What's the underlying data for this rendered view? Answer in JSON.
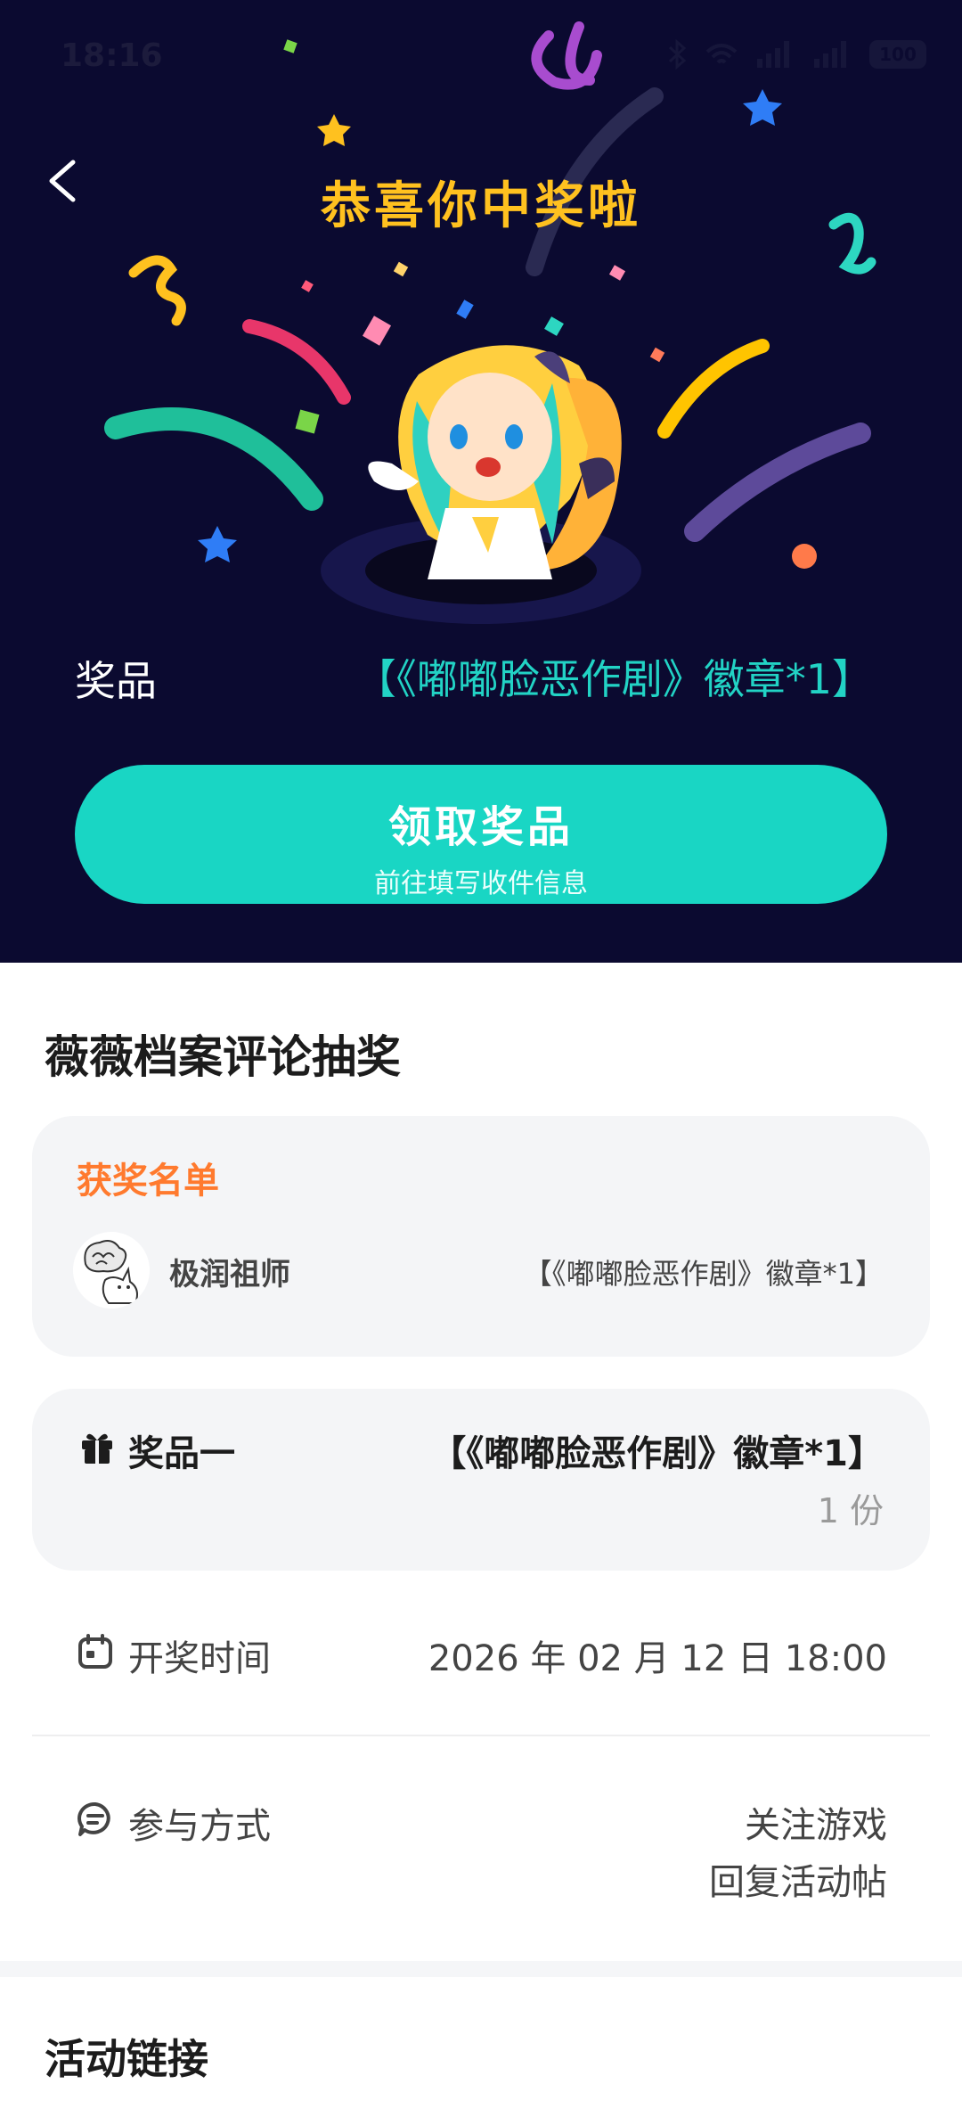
{
  "status_bar": {
    "time": "18:16",
    "battery": "100"
  },
  "header": {
    "title": "恭喜你中奖啦"
  },
  "prize": {
    "label": "奖品",
    "value": "【《嘟嘟脸恶作剧》徽章*1】"
  },
  "claim_button": {
    "label": "领取奖品",
    "sublabel": "前往填写收件信息"
  },
  "event": {
    "title": "薇薇档案评论抽奖"
  },
  "winners": {
    "title": "获奖名单",
    "items": [
      {
        "name": "极润祖师",
        "prize": "【《嘟嘟脸恶作剧》徽章*1】"
      }
    ]
  },
  "prize_tier": {
    "label": "奖品一",
    "value": "【《嘟嘟脸恶作剧》徽章*1】",
    "quantity": "1 份"
  },
  "draw_time": {
    "label": "开奖时间",
    "value": "2026 年 02 月 12 日 18:00"
  },
  "participation": {
    "label": "参与方式",
    "methods": [
      "关注游戏",
      "回复活动帖"
    ]
  },
  "links": {
    "title": "活动链接"
  },
  "colors": {
    "hero_bg": "#0b0a30",
    "accent": "#19d6c4",
    "title_gold": "#ffc11f",
    "winners_orange": "#ff7a2e"
  }
}
